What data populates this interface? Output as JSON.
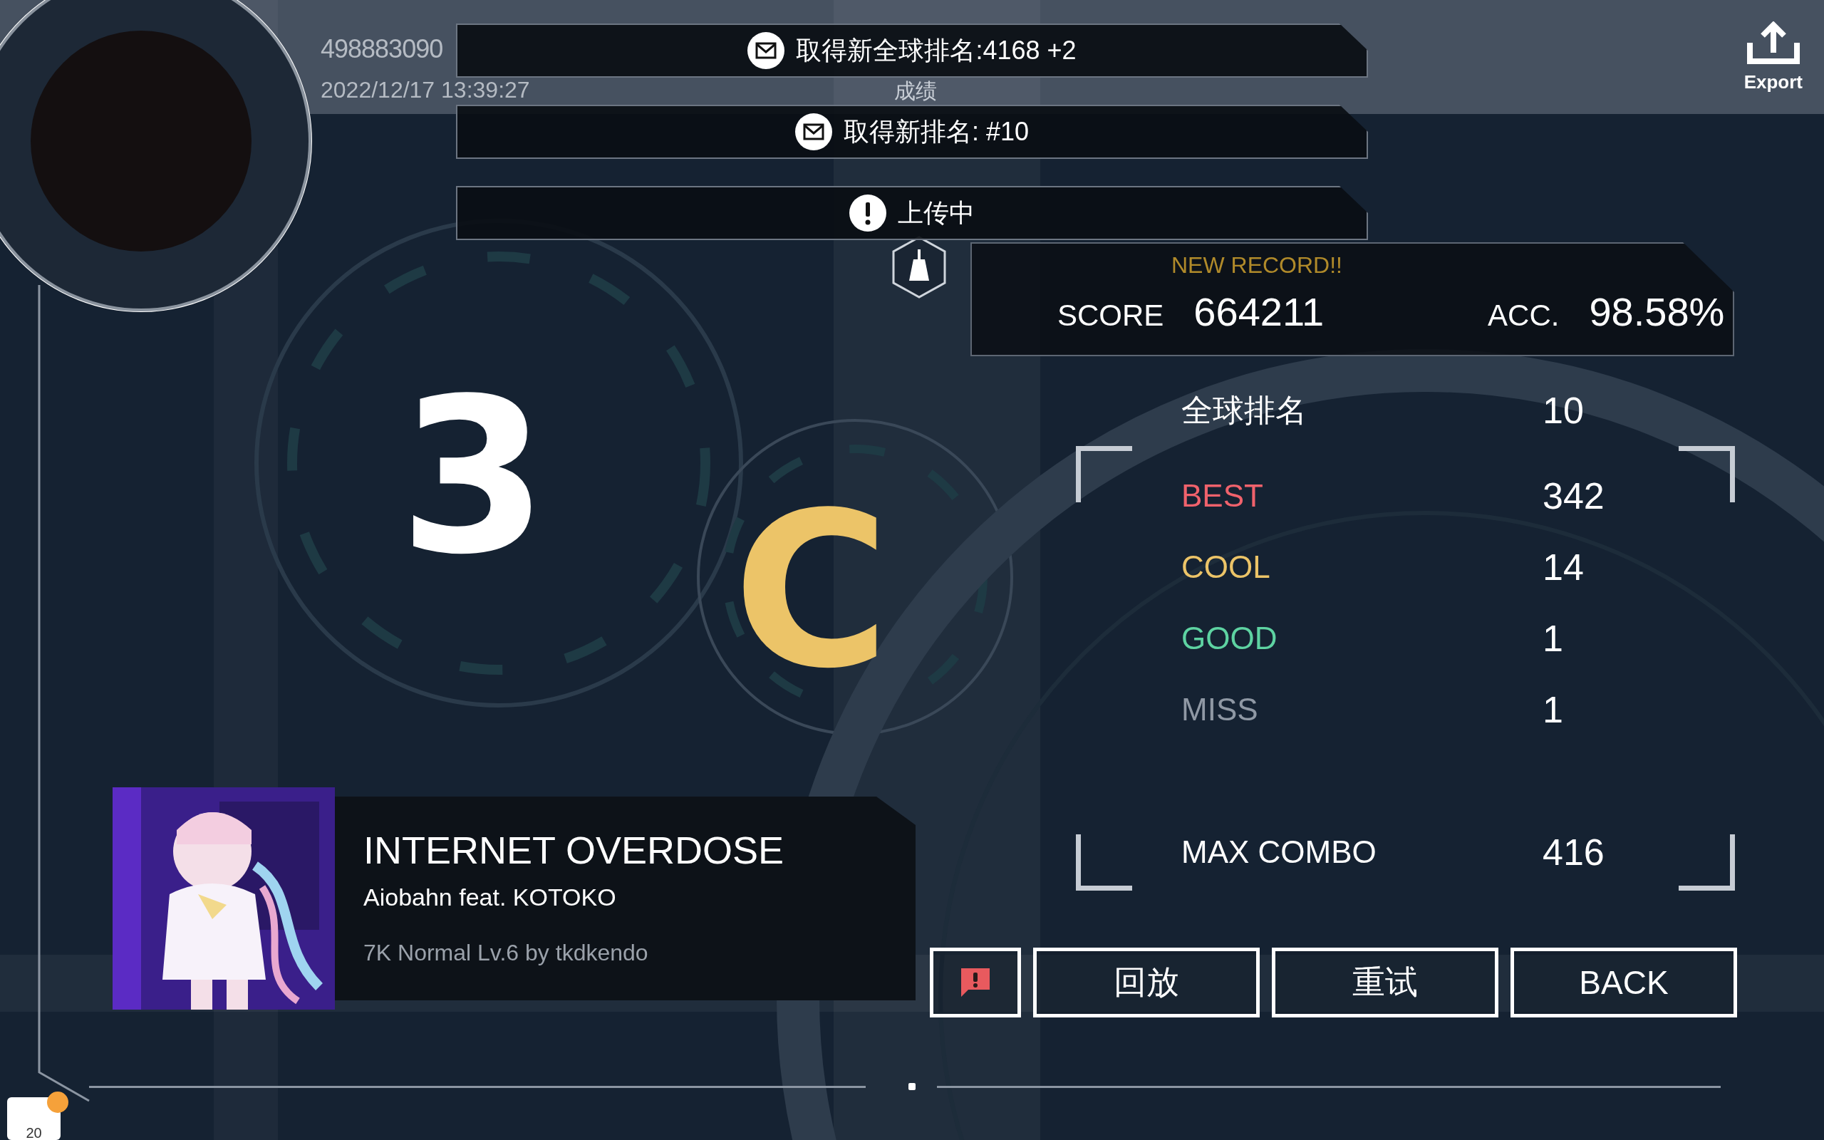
{
  "header": {
    "title": "成绩",
    "user_id": "498883090",
    "timestamp": "2022/12/17 13:39:27",
    "export_label": "Export"
  },
  "notifications": [
    {
      "kind": "mail",
      "text": "取得新全球排名:4168 +2"
    },
    {
      "kind": "mail",
      "text": "取得新排名: #10"
    },
    {
      "kind": "alert",
      "text": "上传中"
    }
  ],
  "grades": [
    {
      "text": "3",
      "color": "#ffffff"
    },
    {
      "text": "C",
      "color": "#ecc468"
    }
  ],
  "result": {
    "new_record": "NEW RECORD!!",
    "score_label": "SCORE",
    "score": "664211",
    "acc_label": "ACC.",
    "acc": "98.58%"
  },
  "stats": [
    {
      "kind": "rank",
      "label": "全球排名",
      "value": "10",
      "color": "#ffffff"
    },
    {
      "kind": "judge",
      "label": "BEST",
      "value": "342",
      "color": "#f0626c"
    },
    {
      "kind": "judge",
      "label": "COOL",
      "value": "14",
      "color": "#ecc468"
    },
    {
      "kind": "judge",
      "label": "GOOD",
      "value": "1",
      "color": "#5ed3a2"
    },
    {
      "kind": "judge",
      "label": "MISS",
      "value": "1",
      "color": "#8f98a4"
    },
    {
      "kind": "combo",
      "label": "MAX COMBO",
      "value": "416",
      "color": "#ffffff"
    }
  ],
  "song": {
    "title": "INTERNET OVERDOSE",
    "artist": "Aiobahn feat. KOTOKO",
    "chart": "7K Normal Lv.6 by tkdkendo"
  },
  "buttons": [
    {
      "kind": "report"
    },
    {
      "kind": "text",
      "label": "回放"
    },
    {
      "kind": "text",
      "label": "重试"
    },
    {
      "kind": "text",
      "label": "BACK"
    }
  ],
  "chat_badge": {
    "count": "20"
  }
}
